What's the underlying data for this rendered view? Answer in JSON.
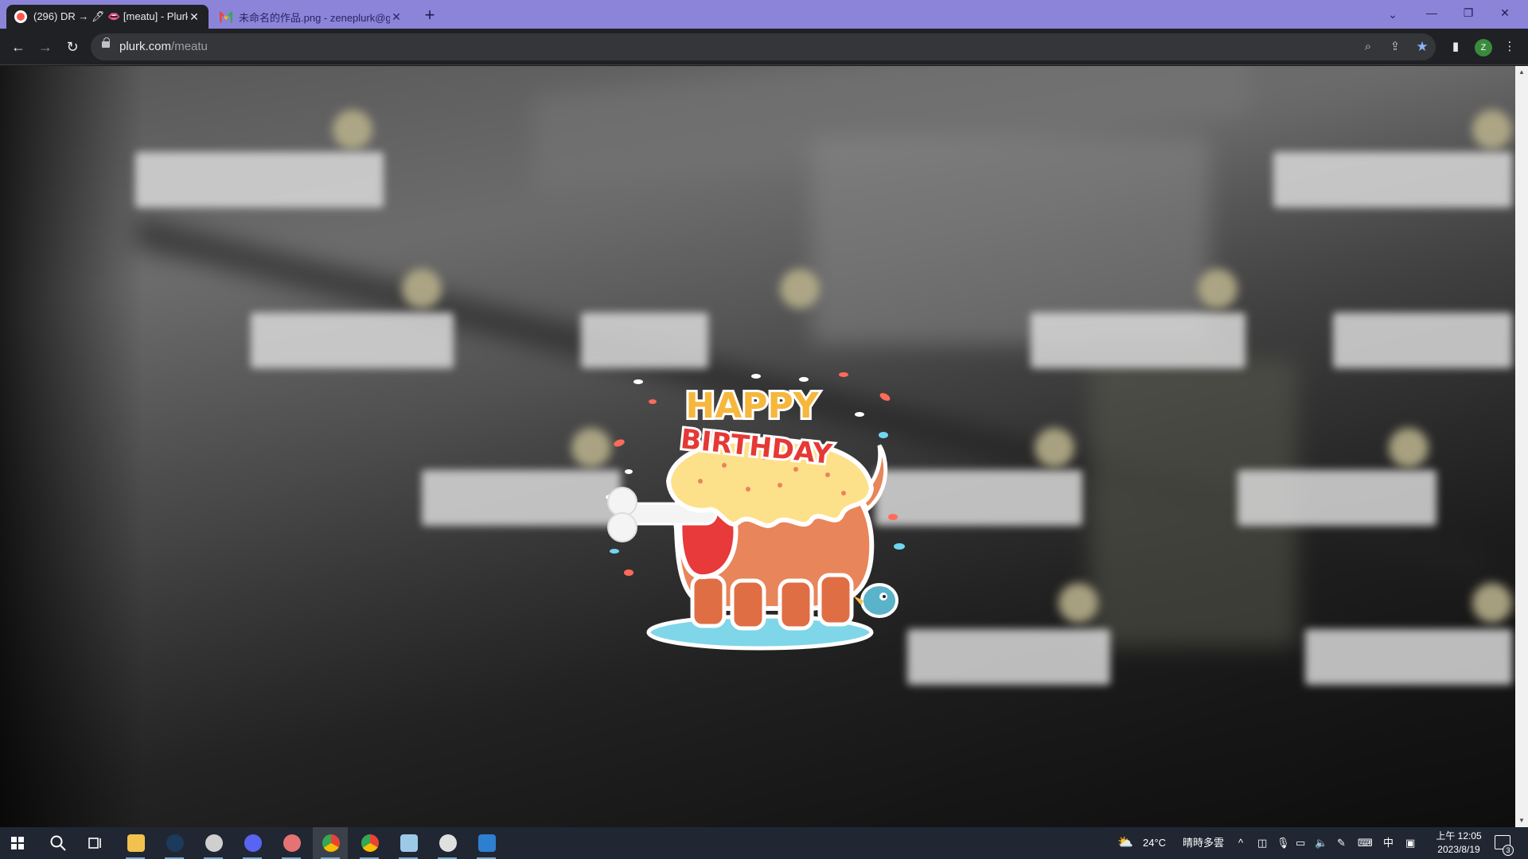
{
  "browser": {
    "tabs": [
      {
        "title": "(296) DR → 🖊 👄 [meatu] - Plurk",
        "active": true
      },
      {
        "title": "未命名的作品.png - zeneplurk@gm",
        "active": false
      }
    ],
    "new_tab_label": "+",
    "window_controls": {
      "minimize": "—",
      "restore": "❐",
      "close": "✕"
    },
    "url_domain": "plurk.com",
    "url_path": "/meatu",
    "profile_initial": "Z"
  },
  "page": {
    "sticker": {
      "line1": "HAPPY",
      "line2": "BIRTHDAY"
    }
  },
  "taskbar": {
    "weather_temp": "24°C",
    "weather_text": "晴時多雲",
    "ime": "中",
    "clock_time": "上午 12:05",
    "clock_date": "2023/8/19",
    "notification_count": "3"
  }
}
